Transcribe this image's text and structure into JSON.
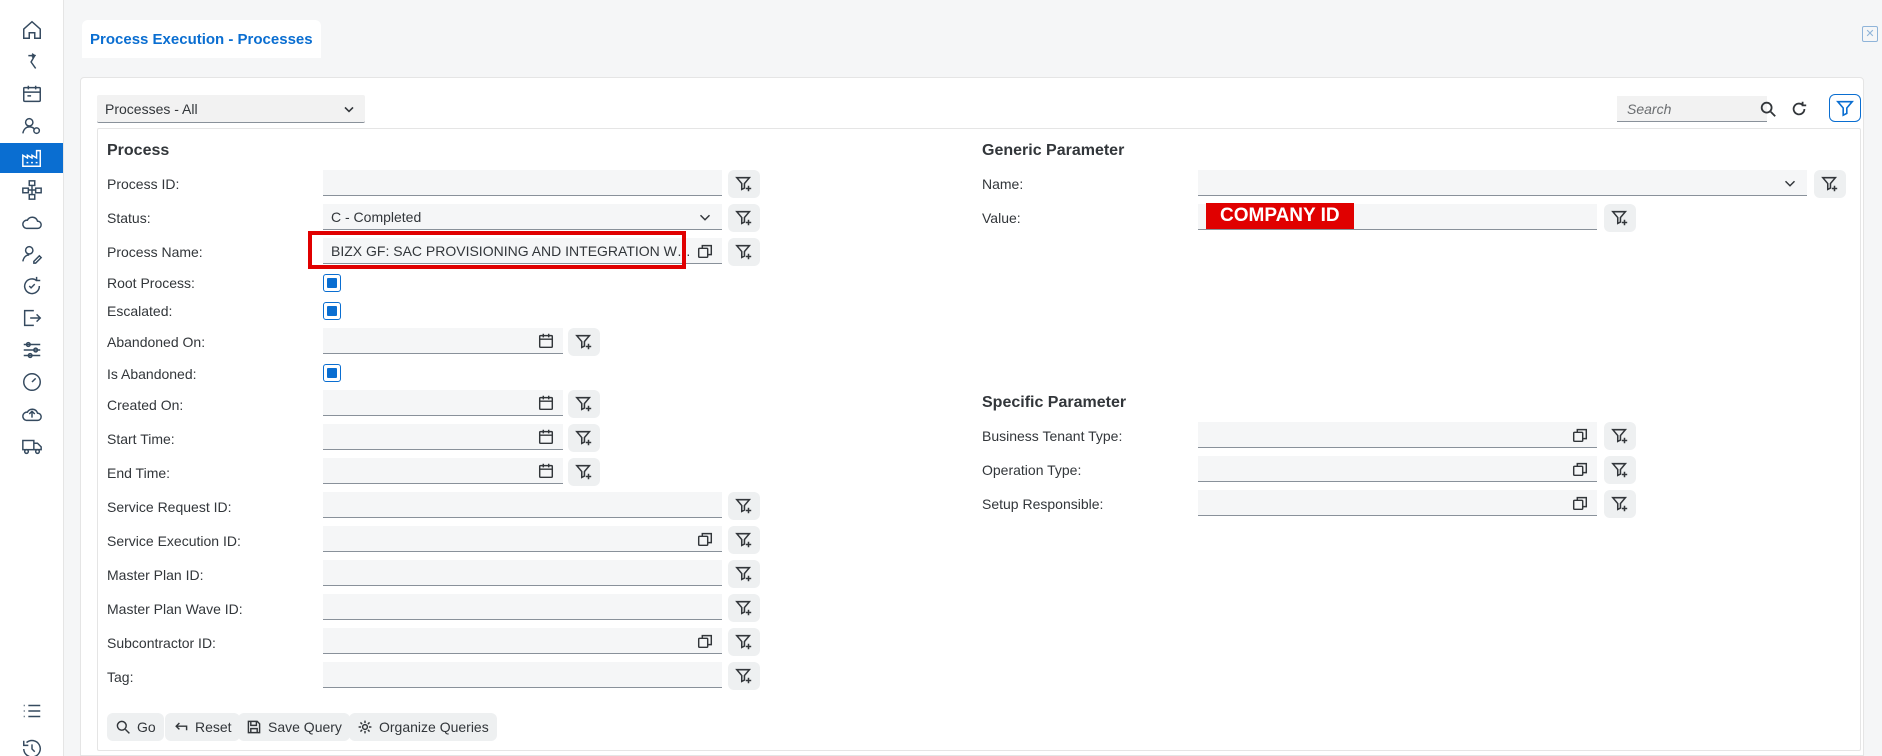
{
  "tab": {
    "title": "Process Execution - Processes"
  },
  "toolbar": {
    "variant": "Processes - All",
    "search_placeholder": "Search"
  },
  "process": {
    "title": "Process",
    "fields": {
      "process_id": {
        "label": "Process ID:",
        "value": ""
      },
      "status": {
        "label": "Status:",
        "value": "C - Completed"
      },
      "process_name": {
        "label": "Process Name:",
        "value": "BIZX GF: SAC PROVISIONING AND INTEGRATION WIT.."
      },
      "root_process": {
        "label": "Root Process:"
      },
      "escalated": {
        "label": "Escalated:"
      },
      "abandoned_on": {
        "label": "Abandoned On:",
        "value": ""
      },
      "is_abandoned": {
        "label": "Is Abandoned:"
      },
      "created_on": {
        "label": "Created On:",
        "value": ""
      },
      "start_time": {
        "label": "Start Time:",
        "value": ""
      },
      "end_time": {
        "label": "End Time:",
        "value": ""
      },
      "service_request_id": {
        "label": "Service Request ID:",
        "value": ""
      },
      "service_execution_id": {
        "label": "Service Execution ID:",
        "value": ""
      },
      "master_plan_id": {
        "label": "Master Plan ID:",
        "value": ""
      },
      "master_plan_wave_id": {
        "label": "Master Plan Wave ID:",
        "value": ""
      },
      "subcontractor_id": {
        "label": "Subcontractor ID:",
        "value": ""
      },
      "tag": {
        "label": "Tag:",
        "value": ""
      }
    }
  },
  "generic": {
    "title": "Generic Parameter",
    "name_label": "Name:",
    "name_value": "",
    "value_label": "Value:",
    "value_redacted": "COMPANY ID"
  },
  "specific": {
    "title": "Specific Parameter",
    "business_tenant_type": "Business Tenant Type:",
    "operation_type": "Operation Type:",
    "setup_responsible": "Setup Responsible:"
  },
  "actions": {
    "go": "Go",
    "reset": "Reset",
    "save_query": "Save Query",
    "organize_queries": "Organize Queries"
  },
  "colors": {
    "accent": "#0a6ed1",
    "highlight": "#e00000"
  }
}
